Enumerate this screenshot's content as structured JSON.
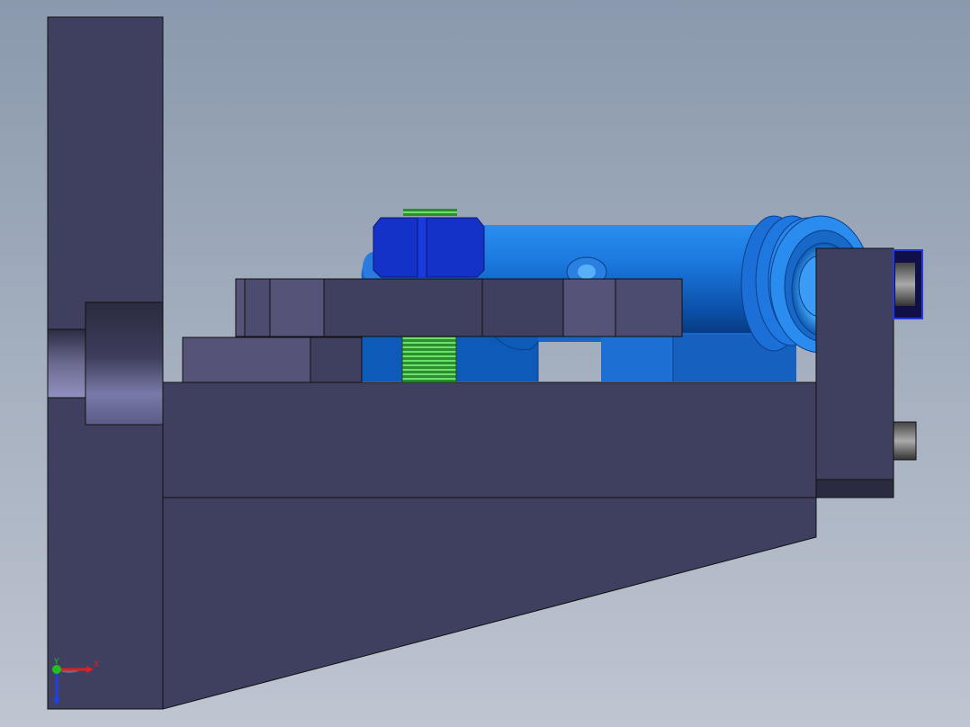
{
  "viewport": {
    "background_top": "#8b9aae",
    "background_bottom": "#bcc3cf",
    "part_color": "#3f3f5f",
    "part_light": "#555478",
    "part_dark": "#2a2a40",
    "cylinder_blue": "#1a7ae0",
    "cylinder_light": "#3aa0f5",
    "cylinder_dark": "#0b4a9a",
    "nut_blue": "#1431c8",
    "thread_green": "#4cc44c"
  },
  "triad": {
    "x_axis_label": "X",
    "y_axis_label": "Y",
    "x_color": "#e02020",
    "y_color": "#20c020",
    "z_color": "#2040e0"
  }
}
